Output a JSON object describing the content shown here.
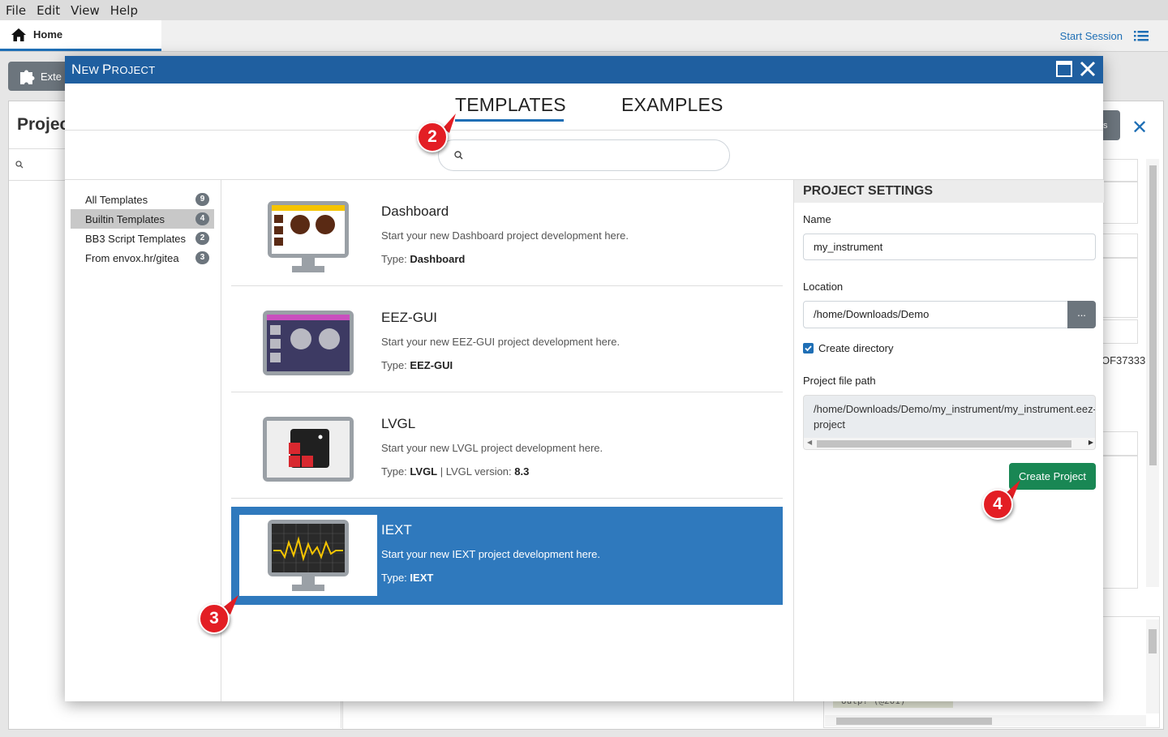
{
  "menu": [
    "File",
    "Edit",
    "View",
    "Help"
  ],
  "tabs": {
    "home_label": "Home",
    "start_session_label": "Start Session"
  },
  "background": {
    "extensions_label": "Exte",
    "projects_title": "Projec",
    "right_button_label": "ts",
    "hash_fragment": "OF37333",
    "console_code": "outp? (@201)"
  },
  "dialog": {
    "title_first": "N",
    "title_rest1": "EW ",
    "title_p": "P",
    "title_rest2": "ROJECT",
    "tabs": [
      "TEMPLATES",
      "EXAMPLES"
    ],
    "search": {
      "value": "",
      "placeholder": ""
    }
  },
  "categories": [
    {
      "label": "All Templates",
      "count": "9"
    },
    {
      "label": "Builtin Templates",
      "count": "4"
    },
    {
      "label": "BB3 Script Templates",
      "count": "2"
    },
    {
      "label": "From envox.hr/gitea",
      "count": "3"
    }
  ],
  "templates": [
    {
      "name": "Dashboard",
      "description": "Start your new Dashboard project development here.",
      "type_label": "Type: ",
      "type_value": "Dashboard",
      "extra": ""
    },
    {
      "name": "EEZ-GUI",
      "description": "Start your new EEZ-GUI project development here.",
      "type_label": "Type: ",
      "type_value": "EEZ-GUI",
      "extra": ""
    },
    {
      "name": "LVGL",
      "description": "Start your new LVGL project development here.",
      "type_label": "Type: ",
      "type_value": "LVGL",
      "extra_sep": " | LVGL version: ",
      "extra_value": "8.3"
    },
    {
      "name": "IEXT",
      "description": "Start your new IEXT project development here.",
      "type_label": "Type: ",
      "type_value": "IEXT",
      "extra": ""
    }
  ],
  "settings": {
    "heading": "PROJECT SETTINGS",
    "name_label": "Name",
    "name_value": "my_instrument",
    "location_label": "Location",
    "location_value": "/home/Downloads/Demo",
    "browse_label": "...",
    "create_directory_label": "Create directory",
    "create_directory_checked": true,
    "file_path_label": "Project file path",
    "file_path_value": "/home/Downloads/Demo/my_instrument/my_instrument.eez-project",
    "create_button": "Create Project"
  },
  "markers": [
    "2",
    "3",
    "4"
  ],
  "colors": {
    "accent": "#1f6fb5",
    "titlebar": "#1f5fa0",
    "selected": "#2f79bd",
    "create": "#198754",
    "marker": "#e31e24"
  }
}
